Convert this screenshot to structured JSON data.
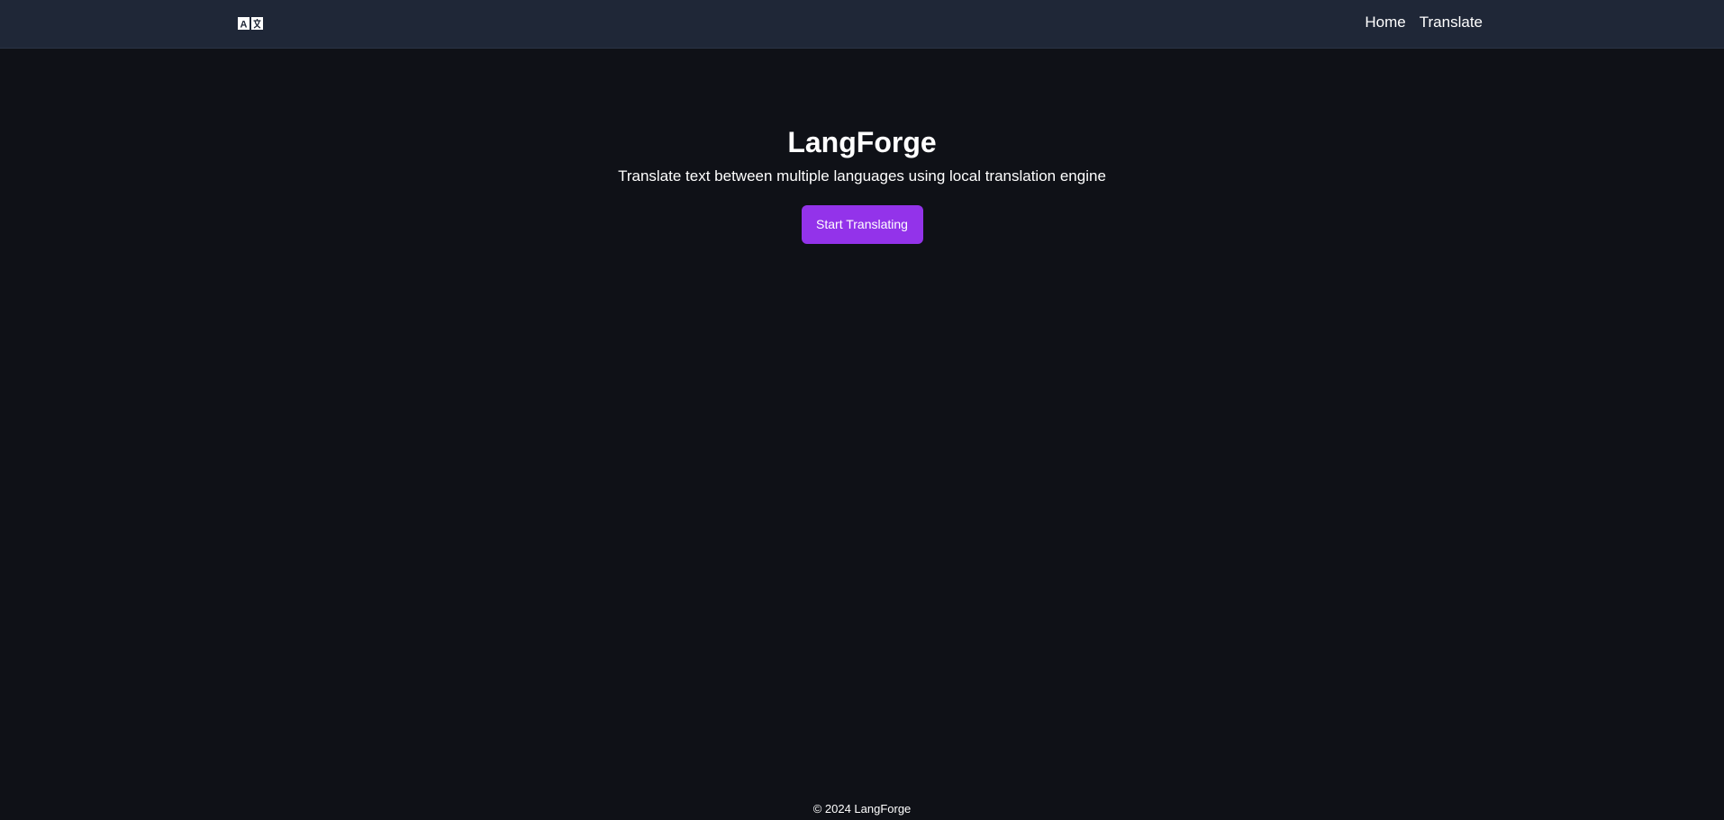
{
  "navbar": {
    "logo_icon": "translate-icon",
    "links": [
      {
        "label": "Home"
      },
      {
        "label": "Translate"
      }
    ]
  },
  "hero": {
    "title": "LangForge",
    "subtitle": "Translate text between multiple languages using local translation engine",
    "cta_label": "Start Translating"
  },
  "footer": {
    "text": "© 2024 LangForge"
  },
  "colors": {
    "background": "#0f1117",
    "navbar": "#1f2737",
    "accent": "#9333ea",
    "text": "#ffffff"
  }
}
